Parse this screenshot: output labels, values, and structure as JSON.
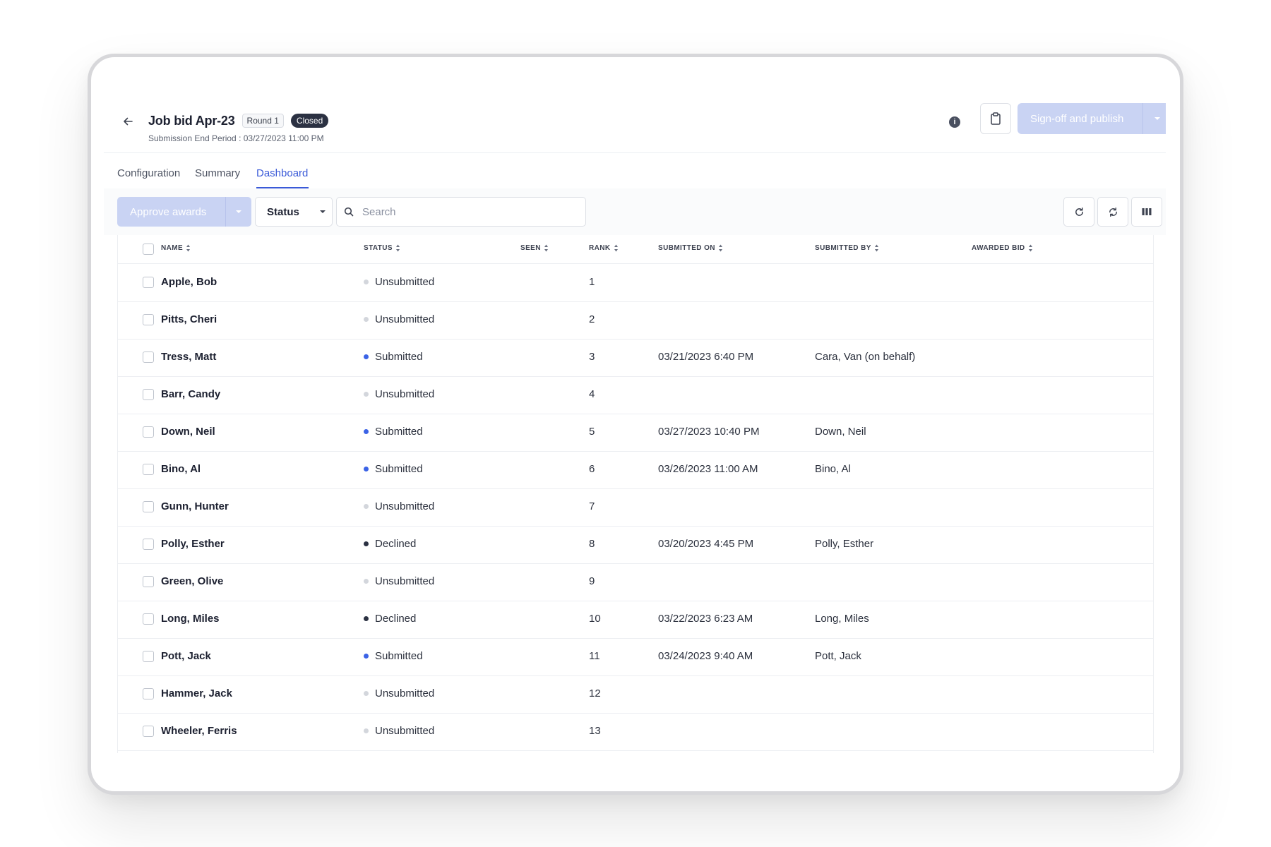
{
  "header": {
    "title": "Job bid Apr-23",
    "round_label": "Round 1",
    "state_badge": "Closed",
    "subtitle": "Submission End Period : 03/27/2023 11:00 PM",
    "publish_label": "Sign-off and publish"
  },
  "tabs": [
    {
      "label": "Configuration",
      "active": false
    },
    {
      "label": "Summary",
      "active": false
    },
    {
      "label": "Dashboard",
      "active": true
    }
  ],
  "toolbar": {
    "approve_label": "Approve awards",
    "status_filter_label": "Status",
    "search_placeholder": "Search"
  },
  "table": {
    "columns": [
      "NAME",
      "STATUS",
      "SEEN",
      "RANK",
      "SUBMITTED ON",
      "SUBMITTED BY",
      "AWARDED BID"
    ],
    "rows": [
      {
        "name": "Apple, Bob",
        "status": "Unsubmitted",
        "seen": "",
        "rank": "1",
        "submitted_on": "",
        "submitted_by": "",
        "awarded_bid": ""
      },
      {
        "name": "Pitts, Cheri",
        "status": "Unsubmitted",
        "seen": "",
        "rank": "2",
        "submitted_on": "",
        "submitted_by": "",
        "awarded_bid": ""
      },
      {
        "name": "Tress, Matt",
        "status": "Submitted",
        "seen": "",
        "rank": "3",
        "submitted_on": "03/21/2023 6:40 PM",
        "submitted_by": "Cara, Van  (on behalf)",
        "awarded_bid": ""
      },
      {
        "name": "Barr, Candy",
        "status": "Unsubmitted",
        "seen": "",
        "rank": "4",
        "submitted_on": "",
        "submitted_by": "",
        "awarded_bid": ""
      },
      {
        "name": "Down, Neil",
        "status": "Submitted",
        "seen": "",
        "rank": "5",
        "submitted_on": "03/27/2023 10:40 PM",
        "submitted_by": "Down, Neil",
        "awarded_bid": ""
      },
      {
        "name": "Bino, Al",
        "status": "Submitted",
        "seen": "",
        "rank": "6",
        "submitted_on": "03/26/2023 11:00 AM",
        "submitted_by": "Bino, Al",
        "awarded_bid": ""
      },
      {
        "name": "Gunn, Hunter",
        "status": "Unsubmitted",
        "seen": "",
        "rank": "7",
        "submitted_on": "",
        "submitted_by": "",
        "awarded_bid": ""
      },
      {
        "name": "Polly, Esther",
        "status": "Declined",
        "seen": "",
        "rank": "8",
        "submitted_on": "03/20/2023 4:45 PM",
        "submitted_by": "Polly, Esther",
        "awarded_bid": ""
      },
      {
        "name": "Green, Olive",
        "status": "Unsubmitted",
        "seen": "",
        "rank": "9",
        "submitted_on": "",
        "submitted_by": "",
        "awarded_bid": ""
      },
      {
        "name": "Long, Miles",
        "status": "Declined",
        "seen": "",
        "rank": "10",
        "submitted_on": "03/22/2023 6:23 AM",
        "submitted_by": "Long, Miles",
        "awarded_bid": ""
      },
      {
        "name": "Pott, Jack",
        "status": "Submitted",
        "seen": "",
        "rank": "11",
        "submitted_on": "03/24/2023 9:40 AM",
        "submitted_by": "Pott, Jack",
        "awarded_bid": ""
      },
      {
        "name": "Hammer, Jack",
        "status": "Unsubmitted",
        "seen": "",
        "rank": "12",
        "submitted_on": "",
        "submitted_by": "",
        "awarded_bid": ""
      },
      {
        "name": "Wheeler, Ferris",
        "status": "Unsubmitted",
        "seen": "",
        "rank": "13",
        "submitted_on": "",
        "submitted_by": "",
        "awarded_bid": ""
      }
    ]
  },
  "status_colors": {
    "Submitted": "#3b63e6",
    "Unsubmitted": "#d3d6dc",
    "Declined": "#2b3142"
  },
  "icons": {
    "back": "arrow-left-icon",
    "info": "info-icon",
    "clipboard": "clipboard-icon",
    "refresh": "refresh-icon",
    "sync": "sync-icon",
    "columns": "columns-icon",
    "search": "search-icon"
  }
}
